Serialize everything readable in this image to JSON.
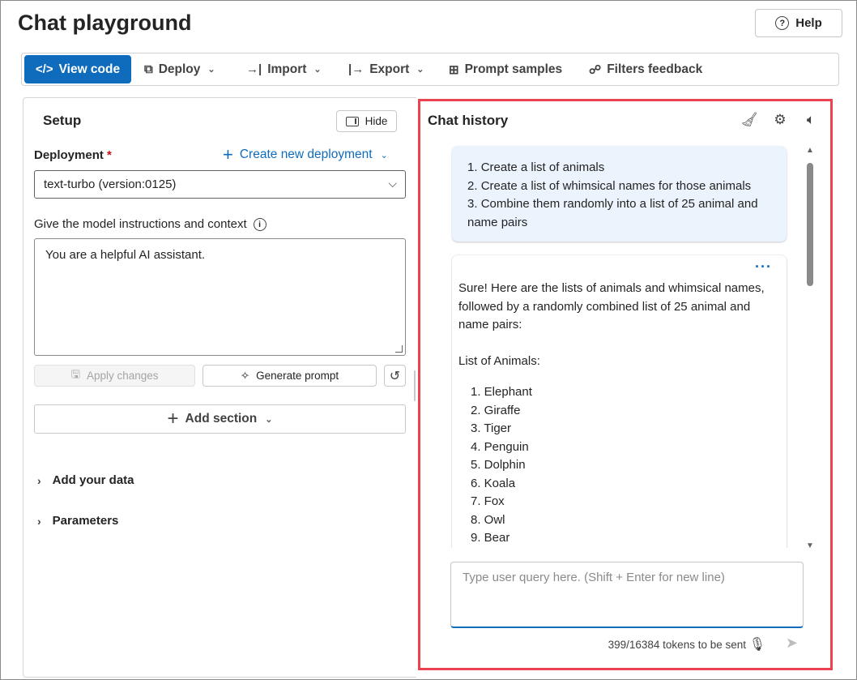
{
  "app": {
    "title": "Chat playground",
    "help_label": "Help",
    "help_icon": "question-circle-icon"
  },
  "toolbar": {
    "items": [
      {
        "label": "View code",
        "icon": "code-icon",
        "primary": true
      },
      {
        "label": "Deploy",
        "icon": "deploy-icon",
        "dropdown": true
      },
      {
        "label": "Import",
        "icon": "import-icon",
        "dropdown": true
      },
      {
        "label": "Export",
        "icon": "export-icon",
        "dropdown": true
      },
      {
        "label": "Prompt samples",
        "icon": "grid-icon"
      },
      {
        "label": "Filters feedback",
        "icon": "feedback-icon"
      }
    ]
  },
  "setup": {
    "title": "Setup",
    "hide_label": "Hide",
    "deployment_label": "Deployment",
    "required_mark": "*",
    "create_deployment_label": "Create new deployment",
    "deployment_value": "text-turbo (version:0125)",
    "instructions_label": "Give the model instructions and context",
    "system_message": "You are a helpful AI assistant.",
    "apply_changes_label": "Apply changes",
    "generate_prompt_label": "Generate prompt",
    "add_section_label": "Add section",
    "accordion": [
      {
        "label": "Add your data"
      },
      {
        "label": "Parameters"
      }
    ]
  },
  "chat": {
    "title": "Chat history",
    "user_message": [
      "Create a list of animals",
      "Create a list of whimsical names for those animals",
      "Combine them randomly into a list of 25 animal and name pairs"
    ],
    "assistant_intro": "Sure! Here are the lists of animals and whimsical names, followed by a randomly combined list of 25 animal and name pairs:",
    "assistant_subheading": "List of Animals:",
    "assistant_list": [
      "1. Elephant",
      "2. Giraffe",
      "3. Tiger",
      "4. Penguin",
      "5. Dolphin",
      "6. Koala",
      "7. Fox",
      "8. Owl",
      "9. Bear"
    ],
    "more_label": "···",
    "query_placeholder": "Type user query here. (Shift + Enter for new line)",
    "tokens_text": "399/16384 tokens to be sent"
  }
}
